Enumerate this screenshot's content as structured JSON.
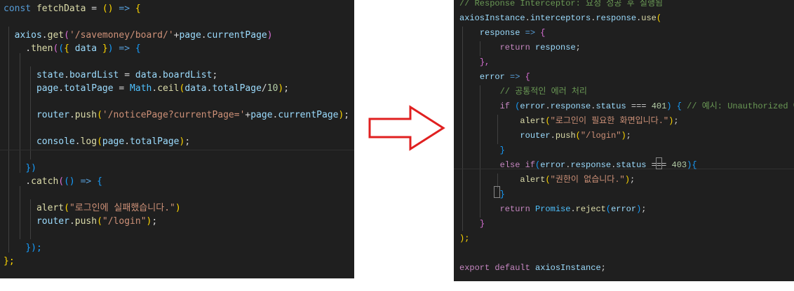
{
  "left_editor": {
    "lines": [
      [
        [
          "const",
          "kw"
        ],
        [
          " ",
          "plain"
        ],
        [
          "fetchData",
          "fn"
        ],
        [
          " = ",
          "plain"
        ],
        [
          "()",
          "p1"
        ],
        [
          " ",
          "plain"
        ],
        [
          "=>",
          "kw"
        ],
        [
          " ",
          "plain"
        ],
        [
          "{",
          "p1"
        ]
      ],
      [],
      [
        [
          "  ",
          "plain"
        ],
        [
          "axios",
          "var"
        ],
        [
          ".",
          "plain"
        ],
        [
          "get",
          "fn"
        ],
        [
          "(",
          "p2"
        ],
        [
          "'/savemoney/board/'",
          "str"
        ],
        [
          "+",
          "plain"
        ],
        [
          "page",
          "var"
        ],
        [
          ".",
          "plain"
        ],
        [
          "currentPage",
          "var"
        ],
        [
          ")",
          "p2"
        ]
      ],
      [
        [
          "    .",
          "plain"
        ],
        [
          "then",
          "fn"
        ],
        [
          "(",
          "p2"
        ],
        [
          "(",
          "p3"
        ],
        [
          "{",
          "p1"
        ],
        [
          " ",
          "plain"
        ],
        [
          "data",
          "var"
        ],
        [
          " ",
          "plain"
        ],
        [
          "}",
          "p1"
        ],
        [
          ")",
          "p3"
        ],
        [
          " ",
          "plain"
        ],
        [
          "=>",
          "kw"
        ],
        [
          " ",
          "plain"
        ],
        [
          "{",
          "p3"
        ]
      ],
      [],
      [
        [
          "      ",
          "plain"
        ],
        [
          "state",
          "var"
        ],
        [
          ".",
          "plain"
        ],
        [
          "boardList",
          "var"
        ],
        [
          " = ",
          "plain"
        ],
        [
          "data",
          "var"
        ],
        [
          ".",
          "plain"
        ],
        [
          "boardList",
          "var"
        ],
        [
          ";",
          "plain"
        ]
      ],
      [
        [
          "      ",
          "plain"
        ],
        [
          "page",
          "var"
        ],
        [
          ".",
          "plain"
        ],
        [
          "totalPage",
          "var"
        ],
        [
          " = ",
          "plain"
        ],
        [
          "Math",
          "const"
        ],
        [
          ".",
          "plain"
        ],
        [
          "ceil",
          "fn"
        ],
        [
          "(",
          "p1"
        ],
        [
          "data",
          "var"
        ],
        [
          ".",
          "plain"
        ],
        [
          "totalPage",
          "var"
        ],
        [
          "/",
          "plain"
        ],
        [
          "10",
          "num"
        ],
        [
          ")",
          "p1"
        ],
        [
          ";",
          "plain"
        ]
      ],
      [],
      [
        [
          "      ",
          "plain"
        ],
        [
          "router",
          "var"
        ],
        [
          ".",
          "plain"
        ],
        [
          "push",
          "fn"
        ],
        [
          "(",
          "p1"
        ],
        [
          "'/noticePage?currentPage='",
          "str"
        ],
        [
          "+",
          "plain"
        ],
        [
          "page",
          "var"
        ],
        [
          ".",
          "plain"
        ],
        [
          "currentPage",
          "var"
        ],
        [
          ")",
          "p1"
        ],
        [
          ";",
          "plain"
        ]
      ],
      [],
      [
        [
          "      ",
          "plain"
        ],
        [
          "console",
          "var"
        ],
        [
          ".",
          "plain"
        ],
        [
          "log",
          "fn"
        ],
        [
          "(",
          "p1"
        ],
        [
          "page",
          "var"
        ],
        [
          ".",
          "plain"
        ],
        [
          "totalPage",
          "var"
        ],
        [
          ")",
          "p1"
        ],
        [
          ";",
          "plain"
        ]
      ],
      [],
      [
        [
          "    ",
          "plain"
        ],
        [
          "})",
          "p3"
        ]
      ],
      [
        [
          "    .",
          "plain"
        ],
        [
          "catch",
          "fn"
        ],
        [
          "(",
          "p2"
        ],
        [
          "()",
          "p3"
        ],
        [
          " ",
          "plain"
        ],
        [
          "=>",
          "kw"
        ],
        [
          " ",
          "plain"
        ],
        [
          "{",
          "p3"
        ]
      ],
      [],
      [
        [
          "      ",
          "plain"
        ],
        [
          "alert",
          "fn"
        ],
        [
          "(",
          "p1"
        ],
        [
          "\"로그인에 실패했습니다.\"",
          "str"
        ],
        [
          ")",
          "p1"
        ]
      ],
      [
        [
          "      ",
          "plain"
        ],
        [
          "router",
          "var"
        ],
        [
          ".",
          "plain"
        ],
        [
          "push",
          "fn"
        ],
        [
          "(",
          "p1"
        ],
        [
          "\"/login\"",
          "str"
        ],
        [
          ")",
          "p1"
        ],
        [
          ";",
          "plain"
        ]
      ],
      [],
      [
        [
          "    ",
          "plain"
        ],
        [
          "});",
          "p3"
        ]
      ],
      [
        [
          "};",
          "p1"
        ]
      ]
    ]
  },
  "right_editor": {
    "lines": [
      [
        [
          "// Response Interceptor: 요청 성공 후 실행됨",
          "com"
        ]
      ],
      [
        [
          "axiosInstance",
          "var"
        ],
        [
          ".",
          "plain"
        ],
        [
          "interceptors",
          "var"
        ],
        [
          ".",
          "plain"
        ],
        [
          "response",
          "var"
        ],
        [
          ".",
          "plain"
        ],
        [
          "use",
          "fn"
        ],
        [
          "(",
          "p1"
        ]
      ],
      [
        [
          "    ",
          "plain"
        ],
        [
          "response",
          "var"
        ],
        [
          " ",
          "plain"
        ],
        [
          "=>",
          "kw"
        ],
        [
          " ",
          "plain"
        ],
        [
          "{",
          "p2"
        ]
      ],
      [
        [
          "        ",
          "plain"
        ],
        [
          "return",
          "ctrl"
        ],
        [
          " ",
          "plain"
        ],
        [
          "response",
          "var"
        ],
        [
          ";",
          "plain"
        ]
      ],
      [
        [
          "    ",
          "plain"
        ],
        [
          "},",
          "p2"
        ]
      ],
      [
        [
          "    ",
          "plain"
        ],
        [
          "error",
          "var"
        ],
        [
          " ",
          "plain"
        ],
        [
          "=>",
          "kw"
        ],
        [
          " ",
          "plain"
        ],
        [
          "{",
          "p2"
        ]
      ],
      [
        [
          "        ",
          "plain"
        ],
        [
          "// 공통적인 에러 처리",
          "com"
        ]
      ],
      [
        [
          "        ",
          "plain"
        ],
        [
          "if",
          "ctrl"
        ],
        [
          " ",
          "plain"
        ],
        [
          "(",
          "p3"
        ],
        [
          "error",
          "var"
        ],
        [
          ".",
          "plain"
        ],
        [
          "response",
          "var"
        ],
        [
          ".",
          "plain"
        ],
        [
          "status",
          "var"
        ],
        [
          " === ",
          "plain"
        ],
        [
          "401",
          "num"
        ],
        [
          ")",
          "p3"
        ],
        [
          " ",
          "plain"
        ],
        [
          "{",
          "p3"
        ],
        [
          " ",
          "plain"
        ],
        [
          "// 예시: Unauthorized 에러 처리",
          "com"
        ]
      ],
      [
        [
          "            ",
          "plain"
        ],
        [
          "alert",
          "fn"
        ],
        [
          "(",
          "p1"
        ],
        [
          "\"로그인이 필요한 화면입니다.\"",
          "str"
        ],
        [
          ")",
          "p1"
        ],
        [
          ";",
          "plain"
        ]
      ],
      [
        [
          "            ",
          "plain"
        ],
        [
          "router",
          "var"
        ],
        [
          ".",
          "plain"
        ],
        [
          "push",
          "fn"
        ],
        [
          "(",
          "p1"
        ],
        [
          "\"/login\"",
          "str"
        ],
        [
          ")",
          "p1"
        ],
        [
          ";",
          "plain"
        ]
      ],
      [
        [
          "        ",
          "plain"
        ],
        [
          "}",
          "p3"
        ]
      ],
      [
        [
          "        ",
          "plain"
        ],
        [
          "else",
          "ctrl"
        ],
        [
          " ",
          "plain"
        ],
        [
          "if",
          "ctrl"
        ],
        [
          "(",
          "p3"
        ],
        [
          "error",
          "var"
        ],
        [
          ".",
          "plain"
        ],
        [
          "response",
          "var"
        ],
        [
          ".",
          "plain"
        ],
        [
          "status",
          "var"
        ],
        [
          " === ",
          "plain"
        ],
        [
          "403",
          "num"
        ],
        [
          ")",
          "p3"
        ],
        [
          "{",
          "p3"
        ]
      ],
      [
        [
          "            ",
          "plain"
        ],
        [
          "alert",
          "fn"
        ],
        [
          "(",
          "p1"
        ],
        [
          "\"권한이 없습니다.\"",
          "str"
        ],
        [
          ")",
          "p1"
        ],
        [
          ";",
          "plain"
        ]
      ],
      [
        [
          "        ",
          "plain"
        ],
        [
          "}",
          "p3"
        ]
      ],
      [
        [
          "        ",
          "plain"
        ],
        [
          "return",
          "ctrl"
        ],
        [
          " ",
          "plain"
        ],
        [
          "Promise",
          "const"
        ],
        [
          ".",
          "plain"
        ],
        [
          "reject",
          "fn"
        ],
        [
          "(",
          "p3"
        ],
        [
          "error",
          "var"
        ],
        [
          ")",
          "p3"
        ],
        [
          ";",
          "plain"
        ]
      ],
      [
        [
          "    ",
          "plain"
        ],
        [
          "}",
          "p2"
        ]
      ],
      [
        [
          ");",
          "p1"
        ]
      ],
      [],
      [
        [
          "export",
          "ctrl"
        ],
        [
          " ",
          "plain"
        ],
        [
          "default",
          "ctrl"
        ],
        [
          " ",
          "plain"
        ],
        [
          "axiosInstance",
          "var"
        ],
        [
          ";",
          "plain"
        ]
      ]
    ]
  },
  "colors": {
    "editor_bg": "#1f1f1f",
    "arrow_fill": "#ffffff",
    "arrow_stroke": "#e02020"
  }
}
